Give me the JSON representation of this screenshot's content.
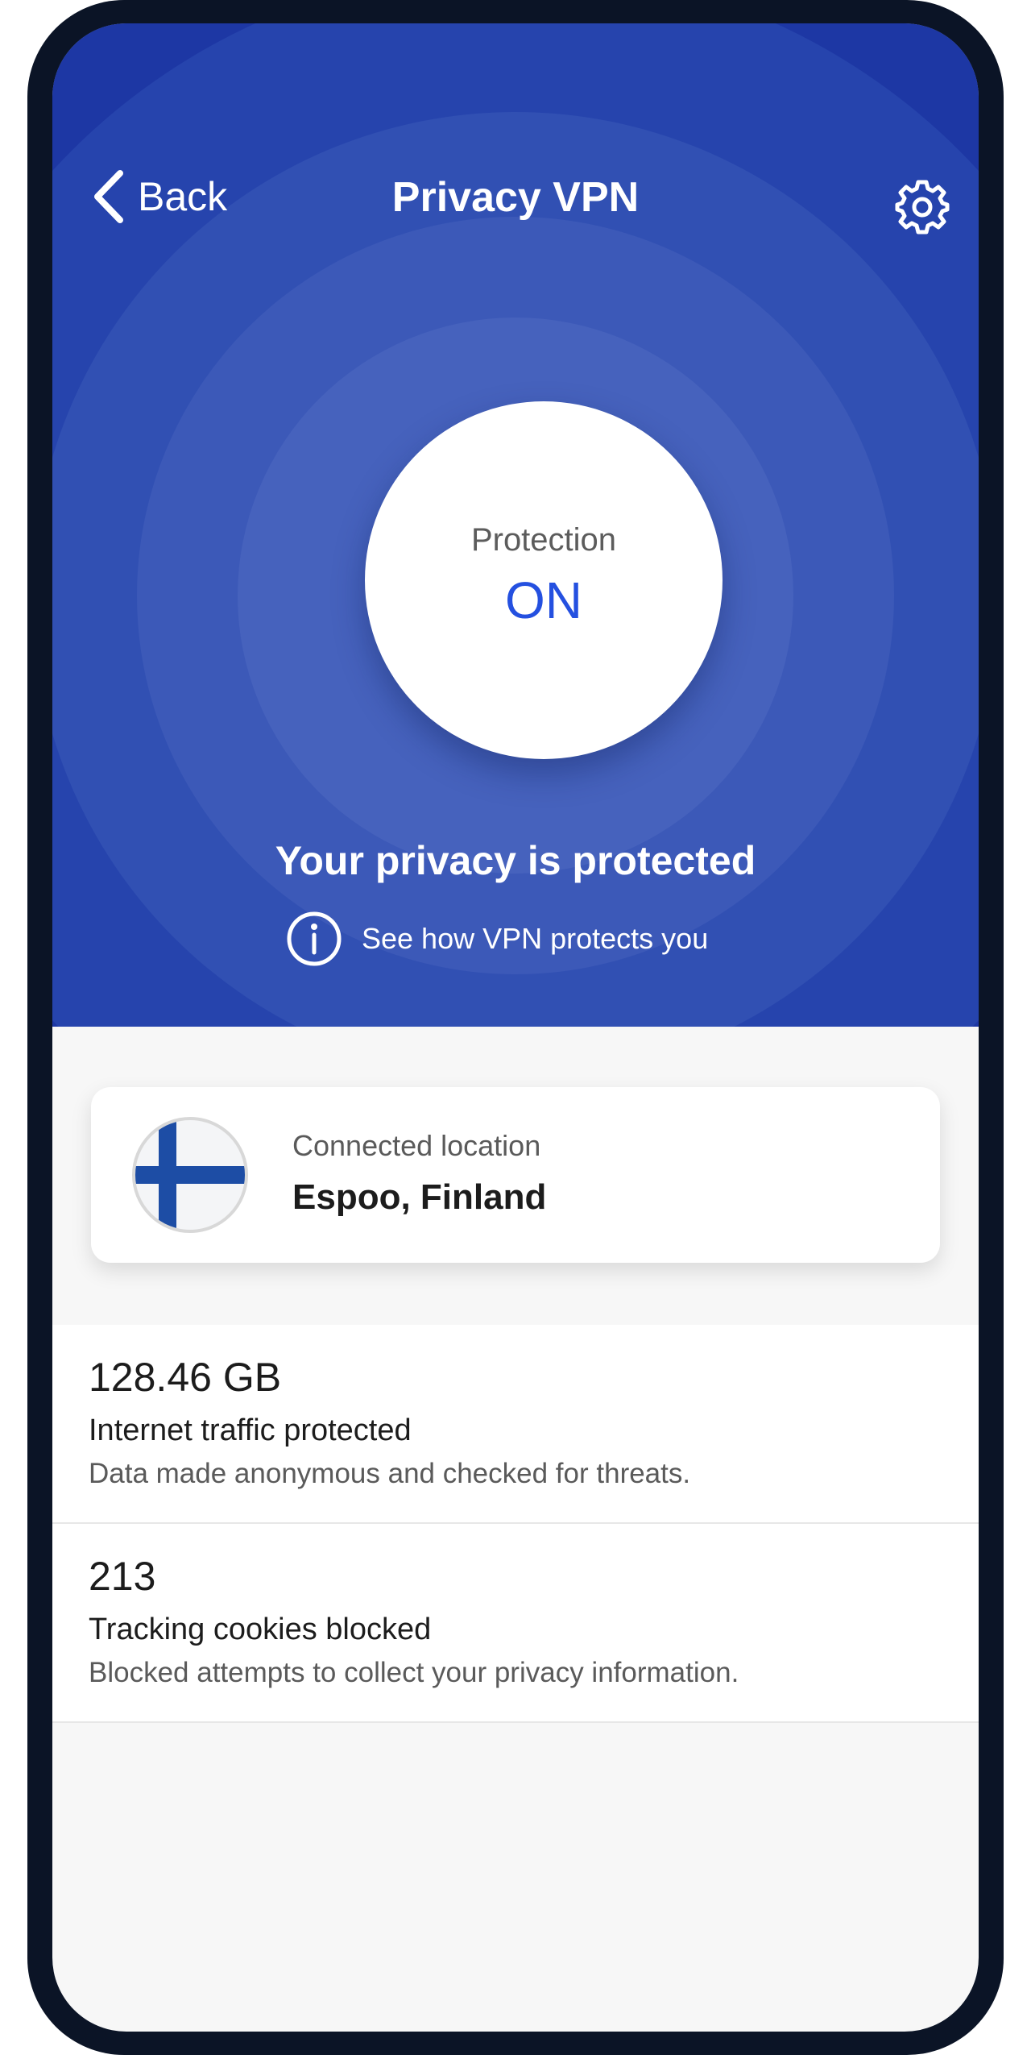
{
  "header": {
    "back_label": "Back",
    "title": "Privacy VPN"
  },
  "protection": {
    "label": "Protection",
    "state": "ON"
  },
  "status": {
    "message": "Your privacy is protected",
    "info_link": "See how VPN protects you"
  },
  "location": {
    "label": "Connected location",
    "value": "Espoo, Finland",
    "flag_icon": "finland-flag-icon"
  },
  "stats": [
    {
      "value": "128.46 GB",
      "title": "Internet traffic protected",
      "description": "Data made anonymous and checked for threats."
    },
    {
      "value": "213",
      "title": "Tracking cookies blocked",
      "description": "Blocked attempts to collect your privacy information."
    }
  ],
  "colors": {
    "hero_blue": "#1f3aa6",
    "accent_blue": "#2450e0",
    "phone_frame": "#0b1426"
  }
}
